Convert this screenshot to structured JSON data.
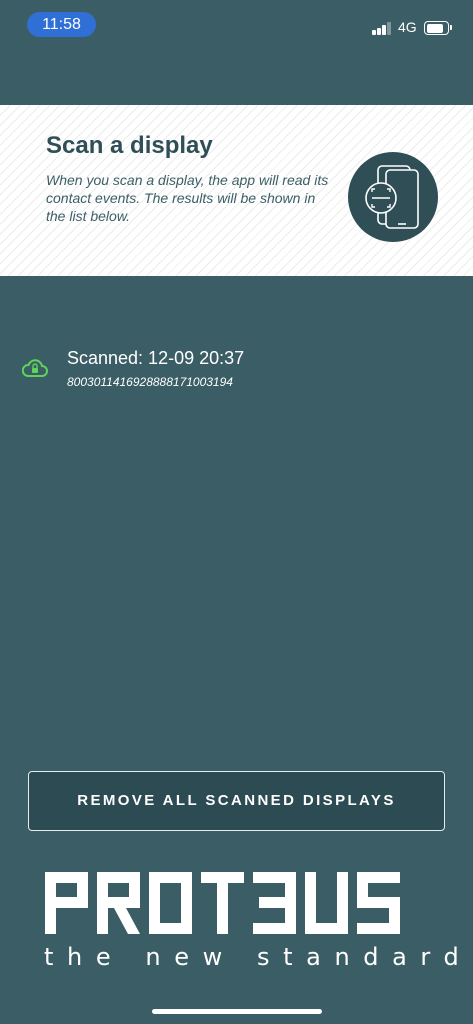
{
  "status_bar": {
    "time": "11:58",
    "network": "4G",
    "signal_bars": 3,
    "battery_level": 0.85
  },
  "banner": {
    "title": "Scan a display",
    "description": "When you scan a display, the app will read its contact events. The results will be shown in the list below.",
    "icon": "phone-scan-icon"
  },
  "scanned_list": [
    {
      "title": "Scanned: 12-09 20:37",
      "id": "800301141692888817100319​4",
      "icon": "cloud-lock-icon",
      "icon_color": "#5fd35a"
    }
  ],
  "actions": {
    "remove_all_label": "REMOVE ALL SCANNED DISPLAYS"
  },
  "brand": {
    "name": "PROTEUS",
    "tagline": "the new standard"
  },
  "colors": {
    "background": "#3b5e66",
    "banner_title": "#2f4e56",
    "button_bg": "#2c4b53",
    "status_pill": "#2f6fd6",
    "accent_green": "#5fd35a"
  }
}
